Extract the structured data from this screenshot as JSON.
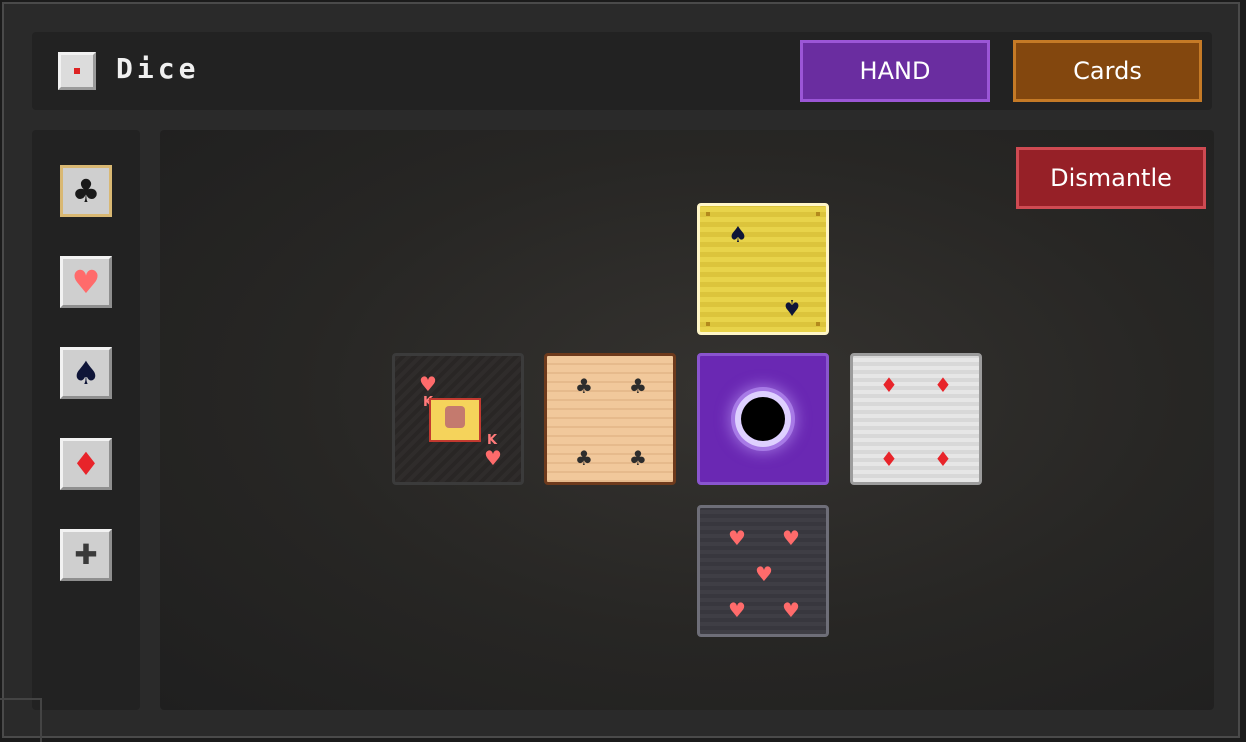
{
  "header": {
    "title": "Dice",
    "hand_label": "HAND",
    "cards_label": "Cards"
  },
  "actions": {
    "dismantle_label": "Dismantle"
  },
  "sidebar": {
    "items": [
      {
        "icon": "club-icon",
        "glyph": "♣",
        "selected": true
      },
      {
        "icon": "heart-icon",
        "glyph": "♥",
        "selected": false
      },
      {
        "icon": "spade-icon",
        "glyph": "♠",
        "selected": false
      },
      {
        "icon": "diamond-icon",
        "glyph": "♦",
        "selected": false
      },
      {
        "icon": "plus-icon",
        "glyph": "✚",
        "selected": false
      }
    ]
  },
  "die_faces": {
    "top": {
      "suit": "spade",
      "glyph": "♠",
      "pips": 2,
      "style": "yellow"
    },
    "left": {
      "suit": "heart",
      "glyph": "♥",
      "rank": "K",
      "style": "king"
    },
    "center_left": {
      "suit": "club",
      "glyph": "♣",
      "pips": 4,
      "style": "wood"
    },
    "center": {
      "suit": "none",
      "style": "void-portal"
    },
    "right": {
      "suit": "diamond",
      "glyph": "♦",
      "pips": 4,
      "style": "white"
    },
    "bottom": {
      "suit": "heart",
      "glyph": "♥",
      "pips": 5,
      "style": "slate"
    }
  },
  "colors": {
    "hand_button": "#6a2da0",
    "cards_button": "#83470e",
    "dismantle_button": "#962027",
    "void_face": "#6a28b3",
    "red_suit": "#e8242a",
    "pink_suit": "#ff6b6b",
    "dark_suit": "#0f1538"
  }
}
